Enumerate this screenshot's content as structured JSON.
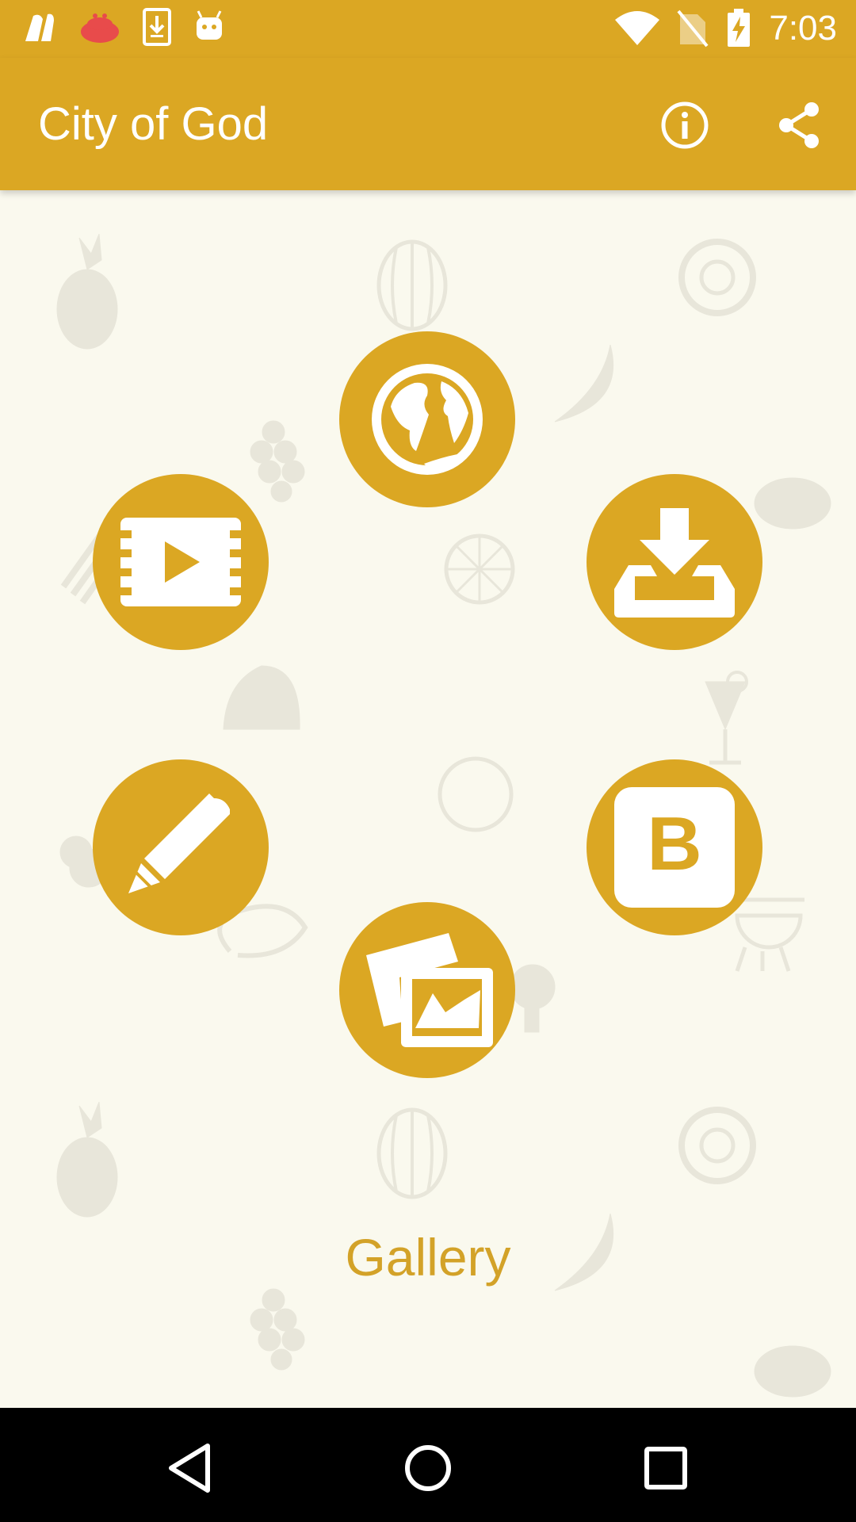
{
  "status_bar": {
    "time": "7:03",
    "left_icons": [
      "app-logo-icon",
      "red-bucket-icon",
      "download-phone-icon",
      "android-robot-icon"
    ],
    "right_icons": [
      "wifi-icon",
      "no-sim-icon",
      "battery-charging-icon"
    ]
  },
  "app_bar": {
    "title": "City of God",
    "actions": [
      "info-icon",
      "share-icon"
    ]
  },
  "menu": {
    "buttons": [
      "globe-icon",
      "video-icon",
      "download-icon",
      "pencil-icon",
      "blogger-icon",
      "gallery-icon"
    ],
    "blogger_letter": "B",
    "selected_label": "Gallery"
  },
  "nav_bar": {
    "buttons": [
      "back-icon",
      "home-icon",
      "recents-icon"
    ]
  },
  "colors": {
    "accent": "#dba723",
    "background": "#faf9ee",
    "label": "#d3a228",
    "deco": "#e6e4d8"
  }
}
